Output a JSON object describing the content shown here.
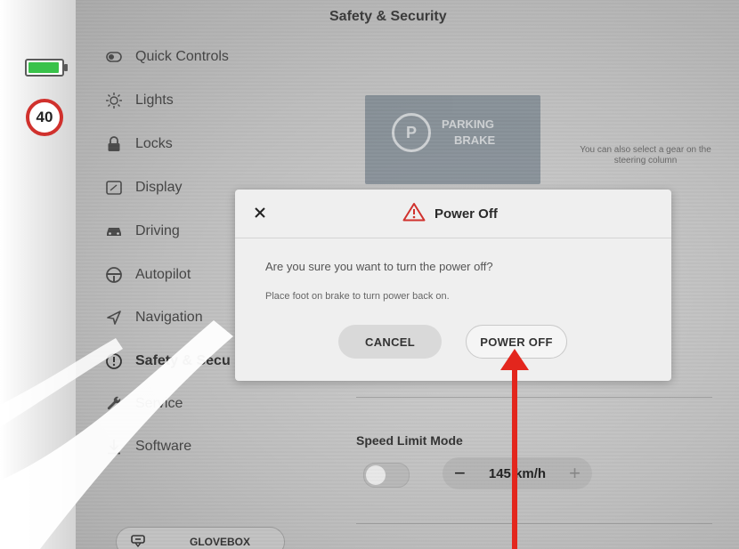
{
  "status": {
    "speed_limit": "40",
    "battery_color": "#39c24a"
  },
  "header": {
    "title": "Safety & Security"
  },
  "sidebar": {
    "items": [
      {
        "label": "Quick Controls",
        "icon": "toggle-icon"
      },
      {
        "label": "Lights",
        "icon": "bulb-icon"
      },
      {
        "label": "Locks",
        "icon": "lock-icon"
      },
      {
        "label": "Display",
        "icon": "display-icon"
      },
      {
        "label": "Driving",
        "icon": "car-icon"
      },
      {
        "label": "Autopilot",
        "icon": "steering-wheel-icon"
      },
      {
        "label": "Navigation",
        "icon": "navigation-icon"
      },
      {
        "label": "Safety & Secu",
        "icon": "alert-circle-icon"
      },
      {
        "label": "Service",
        "icon": "wrench-icon"
      },
      {
        "label": "Software",
        "icon": "download-icon"
      }
    ]
  },
  "panel": {
    "parking_brake_line1": "PARKING",
    "parking_brake_line2": "BRAKE",
    "gear_note": "You can also select a gear on the steering column",
    "speed_limit_mode_label": "Speed Limit Mode",
    "speed_value": "145",
    "speed_unit": "km/h",
    "glovebox_label": "GLOVEBOX"
  },
  "modal": {
    "title": "Power Off",
    "message": "Are you sure you want to turn the power off?",
    "sub_message": "Place foot on brake to turn power back on.",
    "cancel_label": "CANCEL",
    "power_off_label": "POWER OFF"
  },
  "annotation": {
    "arrow_color": "#e3261d"
  }
}
